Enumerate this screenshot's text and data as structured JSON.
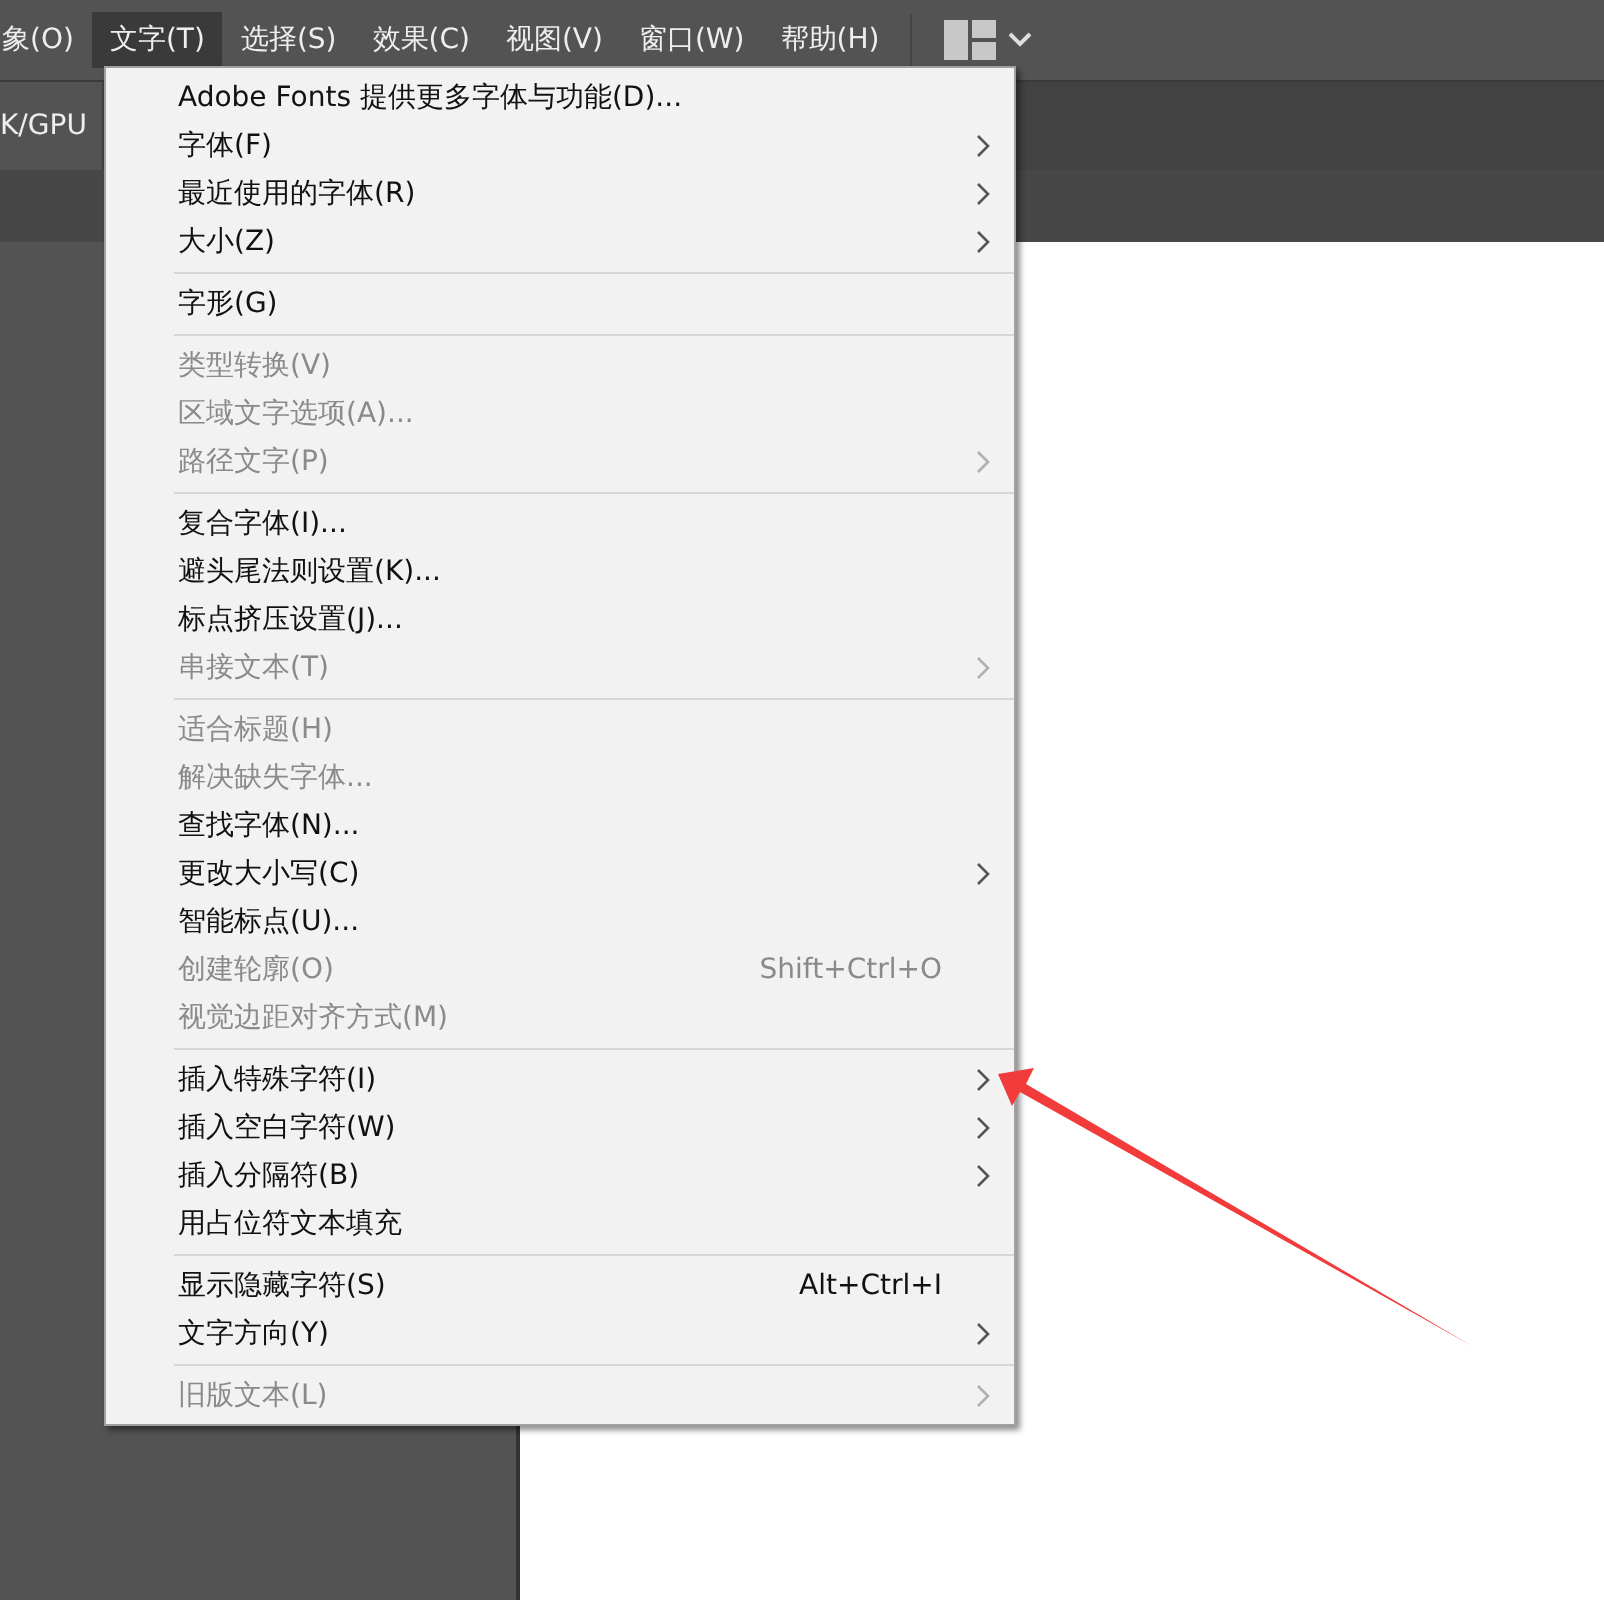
{
  "menu_bar": [
    {
      "label": "象(O)",
      "selected": false
    },
    {
      "label": "文字(T)",
      "selected": true
    },
    {
      "label": "选择(S)",
      "selected": false
    },
    {
      "label": "效果(C)",
      "selected": false
    },
    {
      "label": "视图(V)",
      "selected": false
    },
    {
      "label": "窗口(W)",
      "selected": false
    },
    {
      "label": "帮助(H)",
      "selected": false
    }
  ],
  "document_tab": {
    "label": "K/GPU"
  },
  "menu": {
    "items": [
      {
        "kind": "item",
        "label": "Adobe Fonts 提供更多字体与功能(D)...",
        "disabled": false,
        "submenu": false
      },
      {
        "kind": "item",
        "label": "字体(F)",
        "disabled": false,
        "submenu": true
      },
      {
        "kind": "item",
        "label": "最近使用的字体(R)",
        "disabled": false,
        "submenu": true
      },
      {
        "kind": "item",
        "label": "大小(Z)",
        "disabled": false,
        "submenu": true
      },
      {
        "kind": "separator"
      },
      {
        "kind": "item",
        "label": "字形(G)",
        "disabled": false,
        "submenu": false
      },
      {
        "kind": "separator"
      },
      {
        "kind": "item",
        "label": "类型转换(V)",
        "disabled": true,
        "submenu": false
      },
      {
        "kind": "item",
        "label": "区域文字选项(A)...",
        "disabled": true,
        "submenu": false
      },
      {
        "kind": "item",
        "label": "路径文字(P)",
        "disabled": true,
        "submenu": true
      },
      {
        "kind": "separator"
      },
      {
        "kind": "item",
        "label": "复合字体(I)...",
        "disabled": false,
        "submenu": false
      },
      {
        "kind": "item",
        "label": "避头尾法则设置(K)...",
        "disabled": false,
        "submenu": false
      },
      {
        "kind": "item",
        "label": "标点挤压设置(J)...",
        "disabled": false,
        "submenu": false
      },
      {
        "kind": "item",
        "label": "串接文本(T)",
        "disabled": true,
        "submenu": true
      },
      {
        "kind": "separator"
      },
      {
        "kind": "item",
        "label": "适合标题(H)",
        "disabled": true,
        "submenu": false
      },
      {
        "kind": "item",
        "label": "解决缺失字体...",
        "disabled": true,
        "submenu": false
      },
      {
        "kind": "item",
        "label": "查找字体(N)...",
        "disabled": false,
        "submenu": false
      },
      {
        "kind": "item",
        "label": "更改大小写(C)",
        "disabled": false,
        "submenu": true
      },
      {
        "kind": "item",
        "label": "智能标点(U)...",
        "disabled": false,
        "submenu": false
      },
      {
        "kind": "item",
        "label": "创建轮廓(O)",
        "disabled": true,
        "submenu": false,
        "shortcut": "Shift+Ctrl+O"
      },
      {
        "kind": "item",
        "label": "视觉边距对齐方式(M)",
        "disabled": true,
        "submenu": false
      },
      {
        "kind": "separator"
      },
      {
        "kind": "item",
        "label": "插入特殊字符(I)",
        "disabled": false,
        "submenu": true
      },
      {
        "kind": "item",
        "label": "插入空白字符(W)",
        "disabled": false,
        "submenu": true
      },
      {
        "kind": "item",
        "label": "插入分隔符(B)",
        "disabled": false,
        "submenu": true
      },
      {
        "kind": "item",
        "label": "用占位符文本填充",
        "disabled": false,
        "submenu": false
      },
      {
        "kind": "separator"
      },
      {
        "kind": "item",
        "label": "显示隐藏字符(S)",
        "disabled": false,
        "submenu": false,
        "shortcut": "Alt+Ctrl+I"
      },
      {
        "kind": "item",
        "label": "文字方向(Y)",
        "disabled": false,
        "submenu": true
      },
      {
        "kind": "separator"
      },
      {
        "kind": "item",
        "label": "旧版文本(L)",
        "disabled": true,
        "submenu": true
      }
    ]
  }
}
